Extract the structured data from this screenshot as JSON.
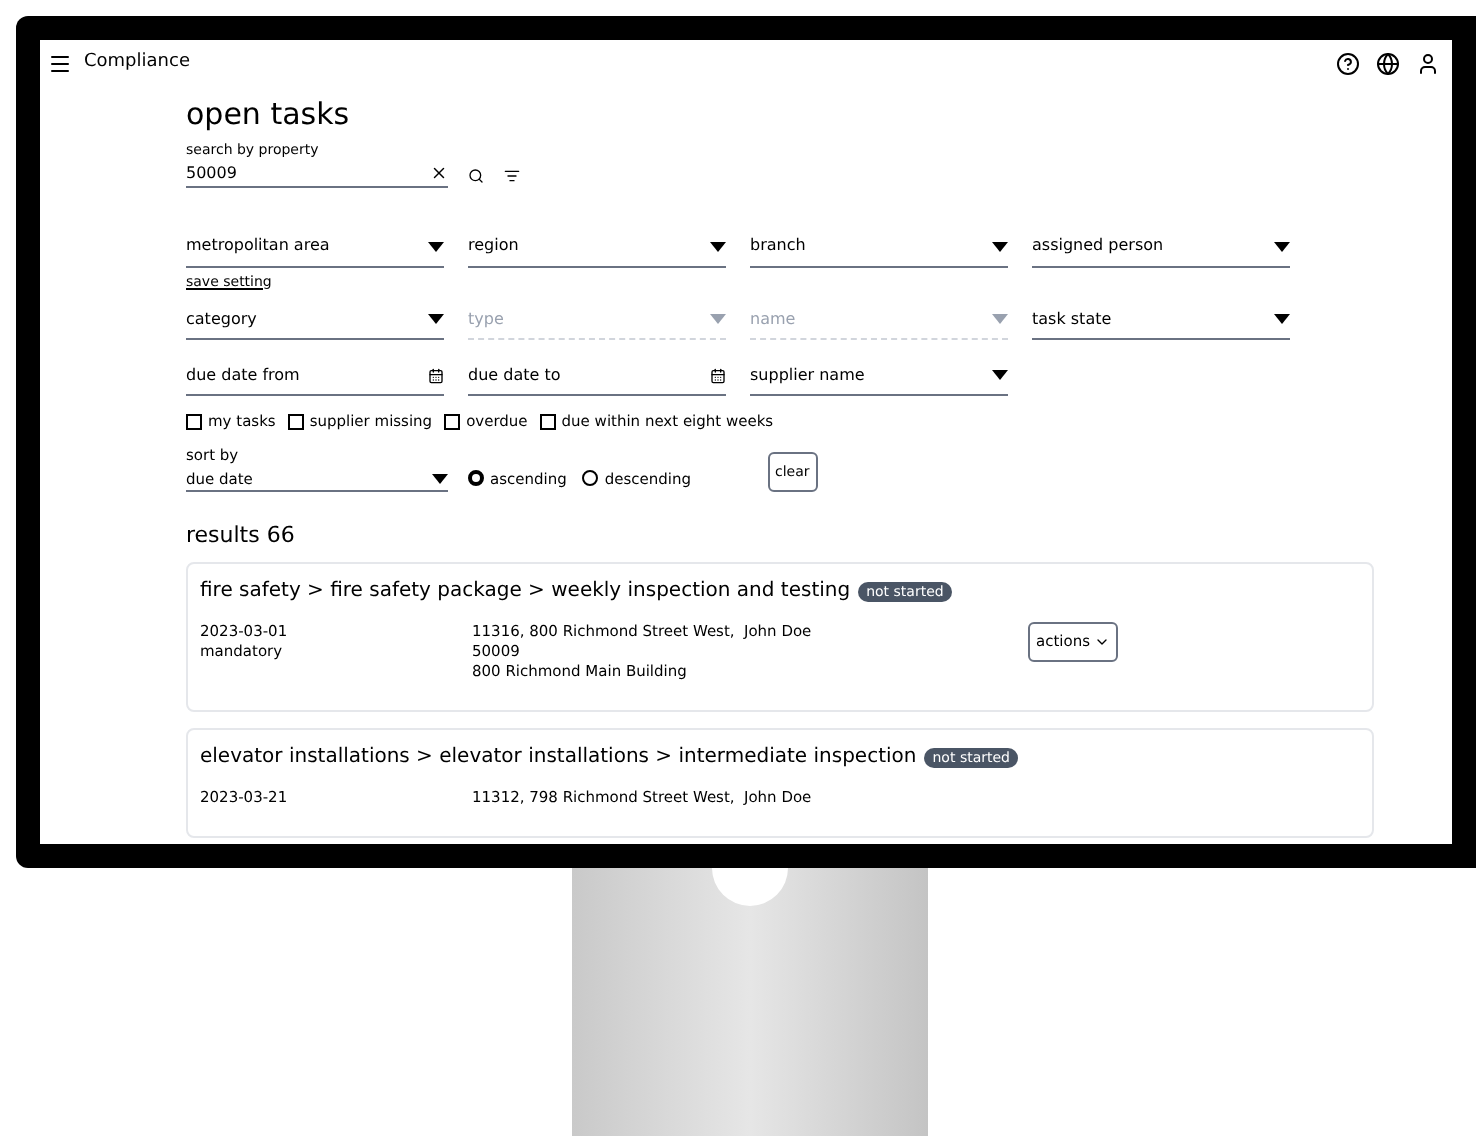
{
  "app_bar": {
    "title": "Compliance"
  },
  "page": {
    "title": "open tasks",
    "search": {
      "label": "search by property",
      "value": "50009"
    },
    "filters": [
      {
        "kind": "select",
        "label": "metropolitan area",
        "disabled": false
      },
      {
        "kind": "select",
        "label": "region",
        "disabled": false
      },
      {
        "kind": "select",
        "label": "branch",
        "disabled": false
      },
      {
        "kind": "select",
        "label": "assigned person",
        "disabled": false
      }
    ],
    "save_setting": "save setting",
    "filters_2": [
      {
        "kind": "select",
        "label": "category",
        "disabled": false
      },
      {
        "kind": "select",
        "label": "type",
        "disabled": true
      },
      {
        "kind": "select",
        "label": "name",
        "disabled": true
      },
      {
        "kind": "select",
        "label": "task state",
        "disabled": false
      }
    ],
    "filters_3": [
      {
        "kind": "date",
        "label": "due date from",
        "disabled": false
      },
      {
        "kind": "date",
        "label": "due date to",
        "disabled": false
      },
      {
        "kind": "select",
        "label": "supplier name",
        "disabled": false
      }
    ],
    "checkboxes": [
      {
        "label": "my tasks",
        "checked": false
      },
      {
        "label": "supplier missing",
        "checked": false
      },
      {
        "label": "overdue",
        "checked": false
      },
      {
        "label": "due within next eight weeks",
        "checked": false
      }
    ],
    "sort": {
      "label": "sort by",
      "value": "due date"
    },
    "order": [
      {
        "label": "ascending",
        "selected": true
      },
      {
        "label": "descending",
        "selected": false
      }
    ],
    "clear_button": "clear",
    "results_title": "results 66",
    "results": [
      {
        "title": "fire safety > fire safety package > weekly inspection and testing",
        "status": "not started",
        "date": "2023-03-01",
        "type": "mandatory",
        "address": [
          "11316, 800 Richmond Street West,",
          "50009",
          "800 Richmond Main Building"
        ],
        "person": "John Doe",
        "action": "actions"
      },
      {
        "title": "elevator installations > elevator installations > intermediate inspection",
        "status": "not started",
        "date": "2023-03-21",
        "address": [
          "11312, 798 Richmond Street West,"
        ],
        "person": "John Doe"
      }
    ]
  }
}
